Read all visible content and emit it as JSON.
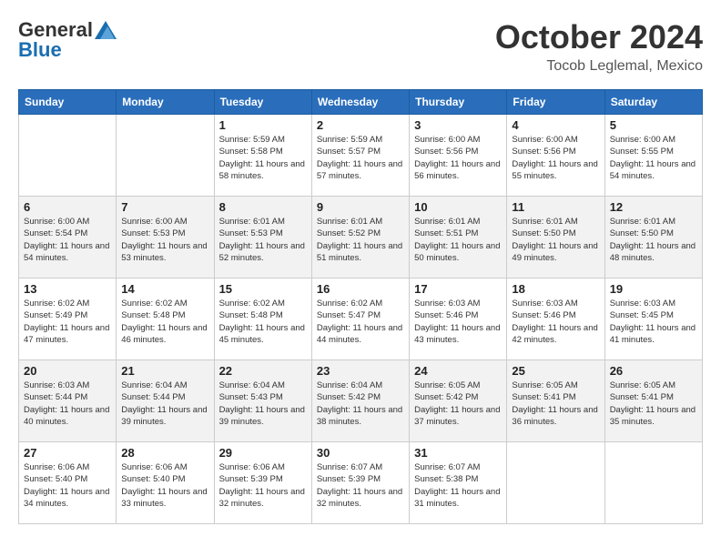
{
  "header": {
    "logo_general": "General",
    "logo_blue": "Blue",
    "month_title": "October 2024",
    "subtitle": "Tocob Leglemal, Mexico"
  },
  "weekdays": [
    "Sunday",
    "Monday",
    "Tuesday",
    "Wednesday",
    "Thursday",
    "Friday",
    "Saturday"
  ],
  "weeks": [
    [
      {
        "day": "",
        "info": ""
      },
      {
        "day": "",
        "info": ""
      },
      {
        "day": "1",
        "info": "Sunrise: 5:59 AM\nSunset: 5:58 PM\nDaylight: 11 hours and 58 minutes."
      },
      {
        "day": "2",
        "info": "Sunrise: 5:59 AM\nSunset: 5:57 PM\nDaylight: 11 hours and 57 minutes."
      },
      {
        "day": "3",
        "info": "Sunrise: 6:00 AM\nSunset: 5:56 PM\nDaylight: 11 hours and 56 minutes."
      },
      {
        "day": "4",
        "info": "Sunrise: 6:00 AM\nSunset: 5:56 PM\nDaylight: 11 hours and 55 minutes."
      },
      {
        "day": "5",
        "info": "Sunrise: 6:00 AM\nSunset: 5:55 PM\nDaylight: 11 hours and 54 minutes."
      }
    ],
    [
      {
        "day": "6",
        "info": "Sunrise: 6:00 AM\nSunset: 5:54 PM\nDaylight: 11 hours and 54 minutes."
      },
      {
        "day": "7",
        "info": "Sunrise: 6:00 AM\nSunset: 5:53 PM\nDaylight: 11 hours and 53 minutes."
      },
      {
        "day": "8",
        "info": "Sunrise: 6:01 AM\nSunset: 5:53 PM\nDaylight: 11 hours and 52 minutes."
      },
      {
        "day": "9",
        "info": "Sunrise: 6:01 AM\nSunset: 5:52 PM\nDaylight: 11 hours and 51 minutes."
      },
      {
        "day": "10",
        "info": "Sunrise: 6:01 AM\nSunset: 5:51 PM\nDaylight: 11 hours and 50 minutes."
      },
      {
        "day": "11",
        "info": "Sunrise: 6:01 AM\nSunset: 5:50 PM\nDaylight: 11 hours and 49 minutes."
      },
      {
        "day": "12",
        "info": "Sunrise: 6:01 AM\nSunset: 5:50 PM\nDaylight: 11 hours and 48 minutes."
      }
    ],
    [
      {
        "day": "13",
        "info": "Sunrise: 6:02 AM\nSunset: 5:49 PM\nDaylight: 11 hours and 47 minutes."
      },
      {
        "day": "14",
        "info": "Sunrise: 6:02 AM\nSunset: 5:48 PM\nDaylight: 11 hours and 46 minutes."
      },
      {
        "day": "15",
        "info": "Sunrise: 6:02 AM\nSunset: 5:48 PM\nDaylight: 11 hours and 45 minutes."
      },
      {
        "day": "16",
        "info": "Sunrise: 6:02 AM\nSunset: 5:47 PM\nDaylight: 11 hours and 44 minutes."
      },
      {
        "day": "17",
        "info": "Sunrise: 6:03 AM\nSunset: 5:46 PM\nDaylight: 11 hours and 43 minutes."
      },
      {
        "day": "18",
        "info": "Sunrise: 6:03 AM\nSunset: 5:46 PM\nDaylight: 11 hours and 42 minutes."
      },
      {
        "day": "19",
        "info": "Sunrise: 6:03 AM\nSunset: 5:45 PM\nDaylight: 11 hours and 41 minutes."
      }
    ],
    [
      {
        "day": "20",
        "info": "Sunrise: 6:03 AM\nSunset: 5:44 PM\nDaylight: 11 hours and 40 minutes."
      },
      {
        "day": "21",
        "info": "Sunrise: 6:04 AM\nSunset: 5:44 PM\nDaylight: 11 hours and 39 minutes."
      },
      {
        "day": "22",
        "info": "Sunrise: 6:04 AM\nSunset: 5:43 PM\nDaylight: 11 hours and 39 minutes."
      },
      {
        "day": "23",
        "info": "Sunrise: 6:04 AM\nSunset: 5:42 PM\nDaylight: 11 hours and 38 minutes."
      },
      {
        "day": "24",
        "info": "Sunrise: 6:05 AM\nSunset: 5:42 PM\nDaylight: 11 hours and 37 minutes."
      },
      {
        "day": "25",
        "info": "Sunrise: 6:05 AM\nSunset: 5:41 PM\nDaylight: 11 hours and 36 minutes."
      },
      {
        "day": "26",
        "info": "Sunrise: 6:05 AM\nSunset: 5:41 PM\nDaylight: 11 hours and 35 minutes."
      }
    ],
    [
      {
        "day": "27",
        "info": "Sunrise: 6:06 AM\nSunset: 5:40 PM\nDaylight: 11 hours and 34 minutes."
      },
      {
        "day": "28",
        "info": "Sunrise: 6:06 AM\nSunset: 5:40 PM\nDaylight: 11 hours and 33 minutes."
      },
      {
        "day": "29",
        "info": "Sunrise: 6:06 AM\nSunset: 5:39 PM\nDaylight: 11 hours and 32 minutes."
      },
      {
        "day": "30",
        "info": "Sunrise: 6:07 AM\nSunset: 5:39 PM\nDaylight: 11 hours and 32 minutes."
      },
      {
        "day": "31",
        "info": "Sunrise: 6:07 AM\nSunset: 5:38 PM\nDaylight: 11 hours and 31 minutes."
      },
      {
        "day": "",
        "info": ""
      },
      {
        "day": "",
        "info": ""
      }
    ]
  ]
}
